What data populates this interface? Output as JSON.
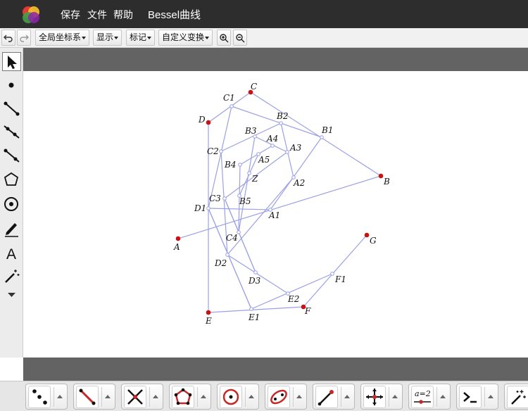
{
  "titlebar": {
    "menu": [
      "保存",
      "文件",
      "帮助"
    ],
    "doc_title": "Bessel曲线"
  },
  "toolbar": {
    "undo_icon": "undo-icon",
    "redo_icon": "redo-icon",
    "coord_dropdown": "全局坐标系",
    "display_dropdown": "显示",
    "mark_dropdown": "标记",
    "transform_dropdown": "自定义变换",
    "zoom_in_icon": "zoom-in-icon",
    "zoom_out_icon": "zoom-out-icon"
  },
  "left_tools": [
    "select-arrow-icon",
    "point-icon",
    "segment-icon",
    "ray-icon",
    "line-icon",
    "polygon-icon",
    "circle-icon",
    "pen-icon",
    "text-tool-icon",
    "magic-wand-icon",
    "more-caret-icon"
  ],
  "bottom_tools": [
    "points-tool-icon",
    "line-tool-icon",
    "intersect-tool-icon",
    "polygon-tool-icon",
    "circle-tool-icon",
    "conic-tool-icon",
    "vector-tool-icon",
    "transform-tool-icon",
    "slider-tool-icon",
    "command-tool-icon",
    "magic-tool-icon"
  ],
  "slider_label": "a=2",
  "colors": {
    "titlebar": "#2d2d2d",
    "gray_bar": "#636363",
    "segment": "#9aa0e6",
    "control_point": "#cc1111",
    "construction_point": "#9aa0e6"
  },
  "geometry": {
    "labels": {
      "A": "A",
      "B": "B",
      "C": "C",
      "D": "D",
      "E": "E",
      "F": "F",
      "G": "G",
      "A1": "A1",
      "B1": "B1",
      "C1": "C1",
      "D1": "D1",
      "E1": "E1",
      "F1": "F1",
      "A2": "A2",
      "B2": "B2",
      "C2": "C2",
      "D2": "D2",
      "E2": "E2",
      "A3": "A3",
      "B3": "B3",
      "C3": "C3",
      "D3": "D3",
      "A4": "A4",
      "B4": "B4",
      "C4": "C4",
      "A5": "A5",
      "B5": "B5",
      "Z": "Z"
    }
  }
}
